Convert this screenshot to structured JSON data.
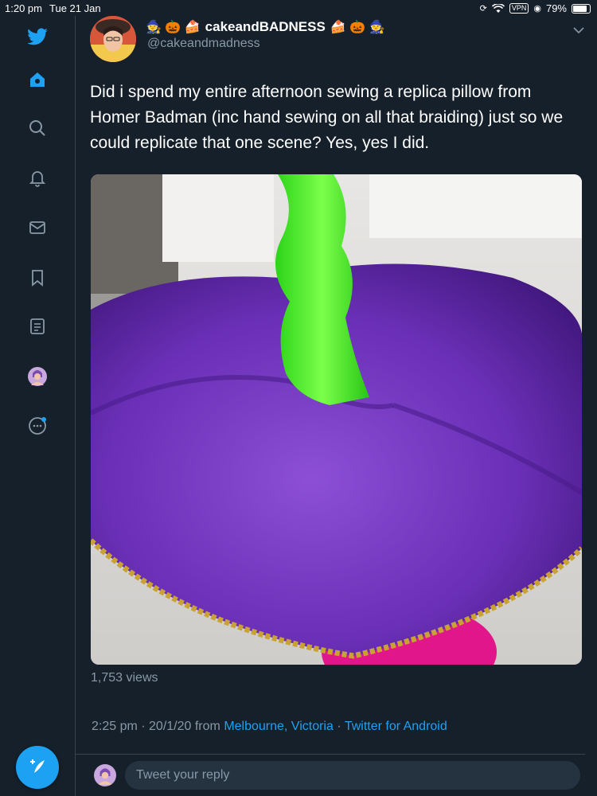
{
  "status": {
    "time": "1:20 pm",
    "date": "Tue 21 Jan",
    "vpn": "VPN",
    "battery": "79%"
  },
  "sidebar": {
    "items": [
      {
        "icon": "twitter-bird-icon"
      },
      {
        "icon": "home-icon"
      },
      {
        "icon": "search-icon"
      },
      {
        "icon": "bell-icon"
      },
      {
        "icon": "mail-icon"
      },
      {
        "icon": "bookmark-icon"
      },
      {
        "icon": "lists-icon"
      },
      {
        "icon": "profile-avatar-icon"
      },
      {
        "icon": "more-icon"
      }
    ],
    "compose_icon": "compose-tweet-icon"
  },
  "tweet": {
    "emoji_left": "🧙 🎃 🍰",
    "display_name": "cakeandBADNESS",
    "emoji_right": "🍰 🎃 🧙",
    "handle": "@cakeandmadness",
    "text": "Did i spend my entire afternoon sewing a replica pillow from Homer Badman (inc hand sewing on all that braiding) just so we could replicate that one scene? Yes, yes I did.",
    "views": "1,753 views",
    "timestamp": "2:25 pm · 20/1/20 from",
    "location": "Melbourne, Victoria",
    "separator": " · ",
    "source": "Twitter for Android"
  },
  "reply": {
    "placeholder": "Tweet your reply"
  },
  "colors": {
    "background": "#15202b",
    "accent": "#1da1f2",
    "muted": "#8899a6",
    "border": "#38444d"
  }
}
